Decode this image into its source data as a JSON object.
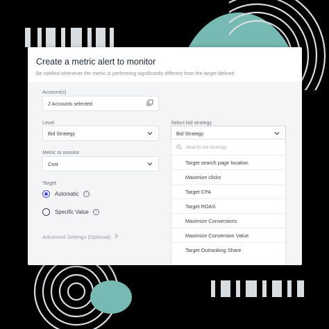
{
  "dialog": {
    "title": "Create a metric alert to monitor",
    "subtitle": "Be notified whenever the metric is performing significantly different from the target defined"
  },
  "accounts": {
    "label": "Account(s)",
    "value": "2 Accounts selected"
  },
  "level": {
    "label": "Level",
    "value": "Bid Strategy"
  },
  "metric": {
    "label": "Metric to monitor",
    "value": "Cost"
  },
  "target": {
    "label": "Target",
    "options": [
      {
        "label": "Automatic",
        "selected": true
      },
      {
        "label": "Specific Value",
        "selected": false
      }
    ]
  },
  "advanced": {
    "label": "Advanced Settings (Optional)"
  },
  "bid_strategy": {
    "label": "Select bid strategy",
    "value": "Bid Strategy",
    "search_placeholder": "Search bid strategy",
    "options": [
      "Target search page location",
      "Maximize clicks",
      "Target CPA",
      "Target ROAS",
      "Maximize Conversions",
      "Maximize Conversion Value",
      "Target Outranking Share"
    ]
  },
  "colors": {
    "accent": "#4b4fd6",
    "teal": "#77b9b3"
  }
}
